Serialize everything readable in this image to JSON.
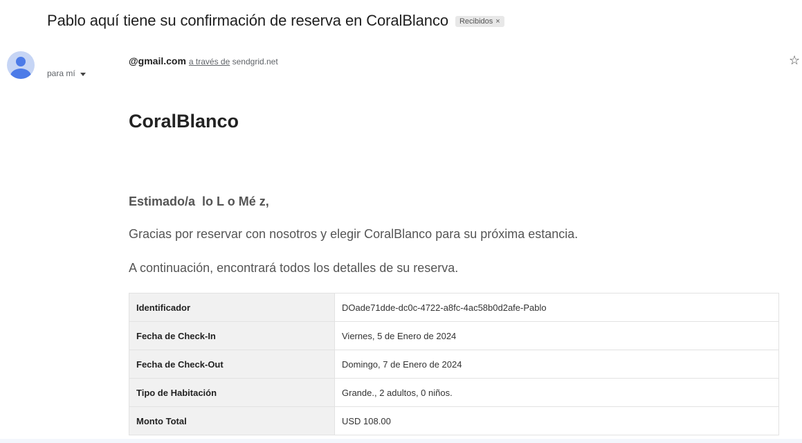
{
  "email": {
    "subject": "Pablo aquí tiene su confirmación de reserva en CoralBlanco",
    "label": "Recibidos",
    "label_close": "×",
    "sender_email_visible": "@gmail.com",
    "via_text": "a través de",
    "via_domain": "sendgrid.net",
    "to_text": "para mí",
    "star_icon": "☆"
  },
  "body": {
    "brand": "CoralBlanco",
    "greeting_prefix": "Estimado/a",
    "greeting_name_partial": "lo L  o Mé  z,",
    "paragraph1": "Gracias por reservar con nosotros y elegir CoralBlanco para su próxima estancia.",
    "paragraph2": "A continuación, encontrará todos los detalles de su reserva."
  },
  "details": [
    {
      "key": "Identificador",
      "value": "DOade71dde-dc0c-4722-a8fc-4ac58b0d2afe-Pablo"
    },
    {
      "key": "Fecha de Check-In",
      "value": "Viernes, 5 de Enero de 2024"
    },
    {
      "key": "Fecha de Check-Out",
      "value": "Domingo, 7 de Enero de 2024"
    },
    {
      "key": "Tipo de Habitación",
      "value": "Grande., 2 adultos, 0 niños."
    },
    {
      "key": "Monto Total",
      "value": "USD 108.00"
    }
  ]
}
